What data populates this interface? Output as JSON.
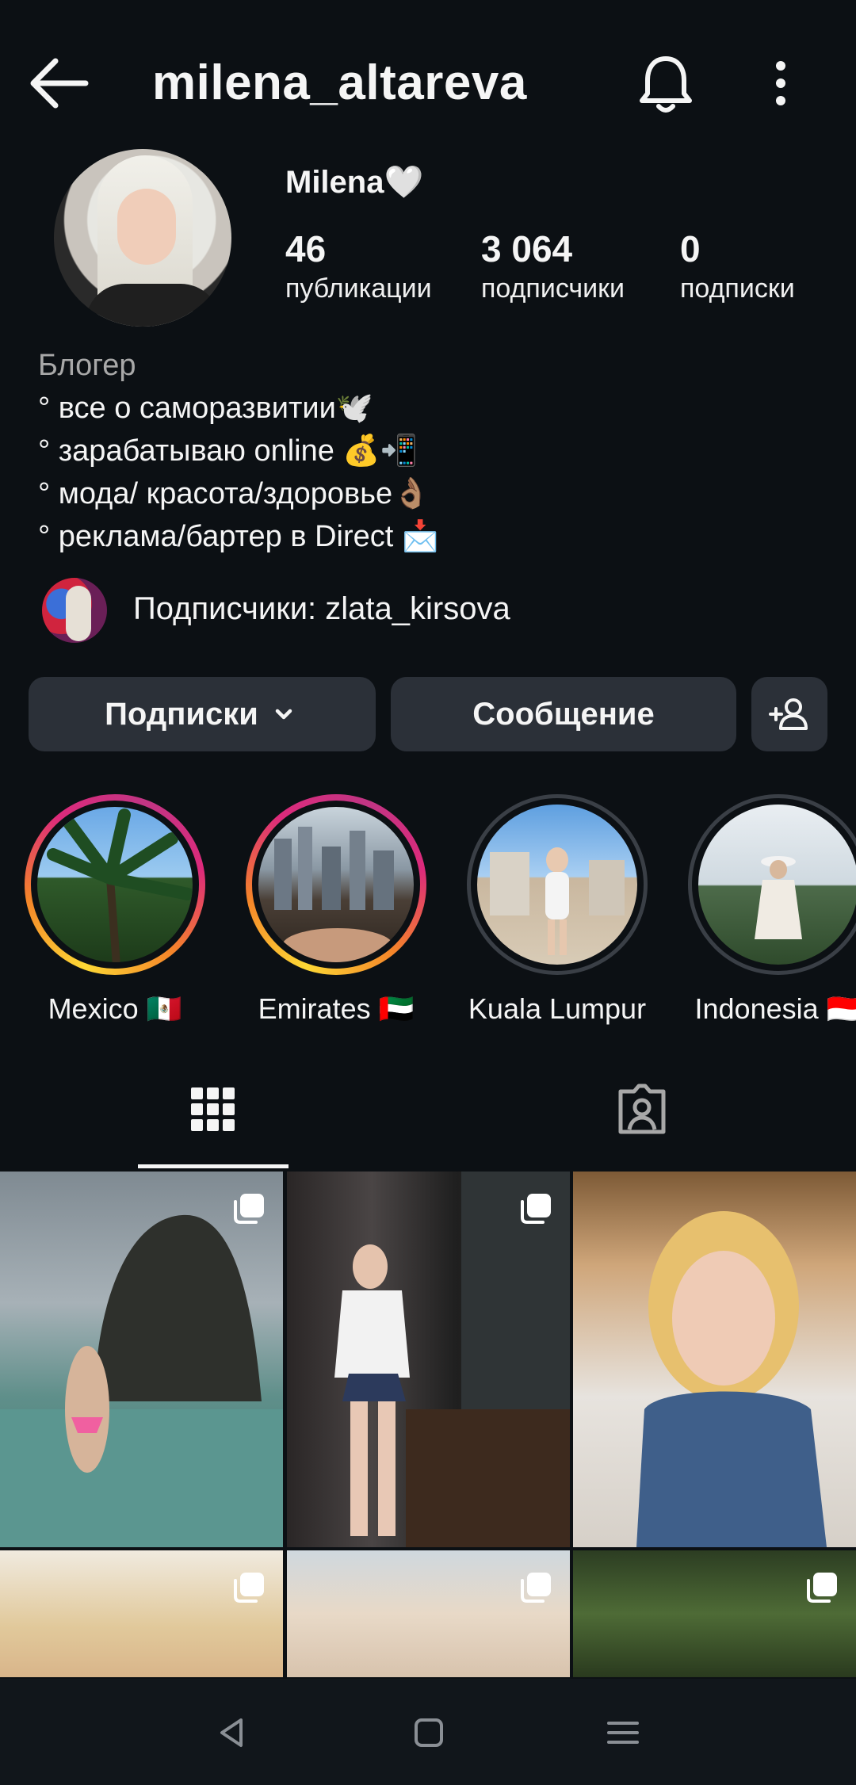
{
  "header": {
    "username": "milena_altareva"
  },
  "profile": {
    "display_name": "Milena🤍",
    "stats": [
      {
        "value": "46",
        "label": "публикации"
      },
      {
        "value": "3 064",
        "label": "подписчики"
      },
      {
        "value": "0",
        "label": "подписки"
      }
    ],
    "bio": {
      "category": "Блогер",
      "lines": [
        "° все о саморазвитии🕊️",
        "° зарабатываю online 💰📲",
        "° мода/ красота/здоровье👌🏽",
        "° реклама/бартер в Direct 📩"
      ]
    },
    "followed_by": "Подписчики: zlata_kirsova"
  },
  "actions": {
    "following": "Подписки",
    "message": "Сообщение"
  },
  "highlights": [
    {
      "label": "Mexico 🇲🇽",
      "state": "active"
    },
    {
      "label": "Emirates 🇦🇪",
      "state": "active"
    },
    {
      "label": "Kuala Lumpur",
      "state": "seen"
    },
    {
      "label": "Indonesia 🇮🇩",
      "state": "seen"
    }
  ],
  "icons": [
    "back-arrow-icon",
    "bell-icon",
    "more-vertical-icon",
    "chevron-down-icon",
    "add-person-icon",
    "grid-icon",
    "tagged-icon",
    "multiple-posts-icon",
    "nav-back-icon",
    "nav-home-icon",
    "nav-menu-icon"
  ],
  "colors": {
    "background": "#0c1014",
    "button": "#2b3038",
    "text": "#f5f5f5",
    "muted": "#a8a8a8"
  }
}
